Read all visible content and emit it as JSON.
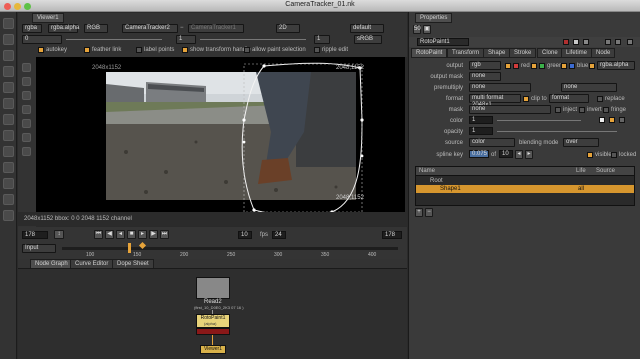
{
  "window": {
    "title": "CameraTracker_01.nk"
  },
  "viewer": {
    "tab_label": "Viewer1",
    "channels": "rgba",
    "channel_alpha": "rgba.alpha",
    "rgb_select": "RGB",
    "input_a": "CameraTracker2",
    "input_b": "CameraTracker1",
    "mode": "2D",
    "lut": "default",
    "frame": "1",
    "fstop": "0",
    "gain": "1",
    "colorspace": "sRGB",
    "options": [
      "autokey",
      "feather link",
      "label points",
      "show transform handle",
      "allow paint selection",
      "ripple edit"
    ],
    "format_label": "2048x1152",
    "bbox_readout": "2048x1152  bbox: 0 0 2048 1152 channel",
    "corner_tl": "2048,1152",
    "corner_br": "2048,1152"
  },
  "timeline": {
    "current_frame": "178",
    "input_label": "Input",
    "fps_label": "fps",
    "fps_value": "24",
    "step_value": "10",
    "ticks": [
      "100",
      "150",
      "200",
      "250",
      "300",
      "350",
      "400"
    ],
    "end_frame": "178"
  },
  "node_graph": {
    "tabs": [
      "Node Graph",
      "Curve Editor",
      "Dope Sheet"
    ],
    "nodes": {
      "read": "Read2",
      "read_sub": "(first_10_D0E0_2K3 07 16 )",
      "roto": "RotoPaint1",
      "roto_sub": "(alpha)",
      "viewer": "Viewer1"
    }
  },
  "properties": {
    "tab_label": "Properties",
    "node_name": "RotoPaint1",
    "tabs": [
      "RotoPaint",
      "Transform",
      "Shape",
      "Stroke",
      "Clone",
      "Lifetime",
      "Node"
    ],
    "output_label": "output",
    "output_value": "rgb",
    "channel_red": "red",
    "channel_green": "green",
    "channel_blue": "blue",
    "channel_alpha": "rgba.alpha",
    "output_mask_label": "output mask",
    "output_mask_value": "none",
    "premult_label": "premultiply",
    "premult_value": "none",
    "premult_right": "none",
    "format_label": "format",
    "format_value": "multi format 2048x1",
    "clip_to_label": "clip to",
    "clip_to_value": "format",
    "replace_label": "replace",
    "mask_label": "mask",
    "mask_value": "none",
    "inject_label": "inject",
    "invert_label": "invert",
    "fringe_label": "fringe",
    "color_label": "color",
    "color_value": "1",
    "opacity_label": "opacity",
    "opacity_value": "1",
    "source_label": "source",
    "source_value": "color",
    "blending_label": "blending mode",
    "blending_value": "over",
    "spline_key_label": "spline key",
    "spline_key_value": "0.075",
    "spline_key_of": "of",
    "spline_key_count": "10",
    "visible_label": "visible",
    "locked_label": "locked",
    "tree_headers": [
      "Name",
      "Life",
      "Source"
    ],
    "tree_rows": [
      {
        "name": "Root",
        "life": "",
        "source": ""
      },
      {
        "name": "Shape1",
        "life": "all",
        "source": ""
      }
    ]
  },
  "colors": {
    "accent": "#e6a33a",
    "selected_row": "#d6962e",
    "roto_node": "#e8d37a",
    "roto_node_bottom": "#8a1818",
    "viewer_node": "#d9b24a"
  }
}
